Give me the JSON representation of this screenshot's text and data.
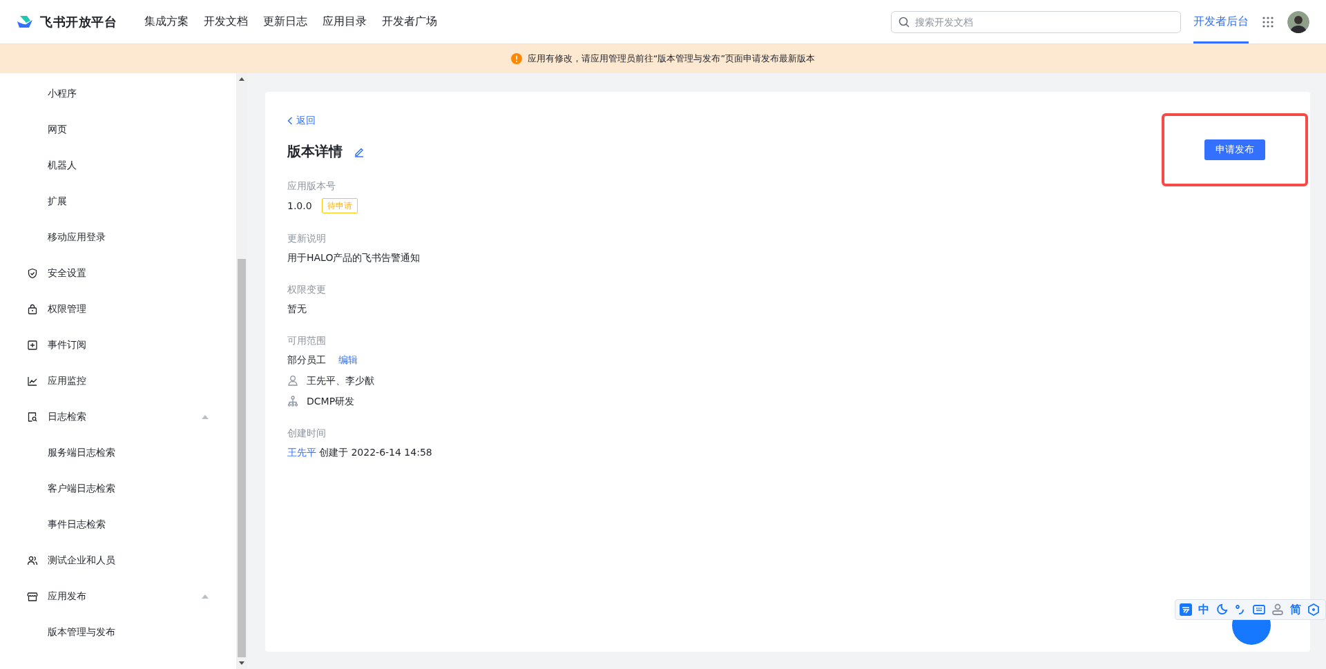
{
  "header": {
    "brand": "飞书开放平台",
    "nav": [
      {
        "label": "集成方案",
        "selected": false
      },
      {
        "label": "开发文档",
        "selected": false
      },
      {
        "label": "更新日志",
        "selected": false
      },
      {
        "label": "应用目录",
        "selected": false
      },
      {
        "label": "开发者广场",
        "selected": false
      }
    ],
    "search": {
      "placeholder": "搜索开发文档"
    },
    "console": {
      "label": "开发者后台",
      "selected": true
    }
  },
  "notice": {
    "text": "应用有修改，请应用管理员前往“版本管理与发布”页面申请发布最新版本"
  },
  "sidebar": {
    "items": [
      {
        "label": "小程序",
        "kind": "sub"
      },
      {
        "label": "网页",
        "kind": "sub"
      },
      {
        "label": "机器人",
        "kind": "sub"
      },
      {
        "label": "扩展",
        "kind": "sub"
      },
      {
        "label": "移动应用登录",
        "kind": "sub"
      },
      {
        "label": "安全设置",
        "kind": "group"
      },
      {
        "label": "权限管理",
        "kind": "group"
      },
      {
        "label": "事件订阅",
        "kind": "group"
      },
      {
        "label": "应用监控",
        "kind": "group"
      },
      {
        "label": "日志检索",
        "kind": "group",
        "expanded": true,
        "children": [
          {
            "label": "服务端日志检索",
            "kind": "sub"
          },
          {
            "label": "客户端日志检索",
            "kind": "sub"
          },
          {
            "label": "事件日志检索",
            "kind": "sub"
          }
        ]
      },
      {
        "label": "测试企业和人员",
        "kind": "group"
      },
      {
        "label": "应用发布",
        "kind": "group",
        "expanded": true,
        "children": [
          {
            "label": "版本管理与发布",
            "kind": "sub"
          }
        ]
      }
    ]
  },
  "detail": {
    "back": "返回",
    "title": "版本详情",
    "action": "申请发布",
    "version": {
      "label": "应用版本号",
      "value": "1.0.0",
      "status": "待申请"
    },
    "notes": {
      "label": "更新说明",
      "value": "用于HALO产品的飞书告警通知"
    },
    "permissions": {
      "label": "权限变更",
      "value": "暂无"
    },
    "scope": {
      "label": "可用范围",
      "value": "部分员工",
      "edit": "编辑",
      "members": "王先平、李少猷",
      "department": "DCMP研发"
    },
    "created": {
      "label": "创建时间",
      "author": "王先平",
      "text": "创建于 2022-6-14 14:58"
    }
  },
  "ime_toolbar": {
    "items": [
      {
        "kind": "logo"
      },
      {
        "kind": "text",
        "label": "中"
      },
      {
        "kind": "moon"
      },
      {
        "kind": "punct"
      },
      {
        "kind": "keyboard"
      },
      {
        "kind": "user"
      },
      {
        "kind": "text",
        "label": "简"
      },
      {
        "kind": "hex"
      }
    ]
  }
}
